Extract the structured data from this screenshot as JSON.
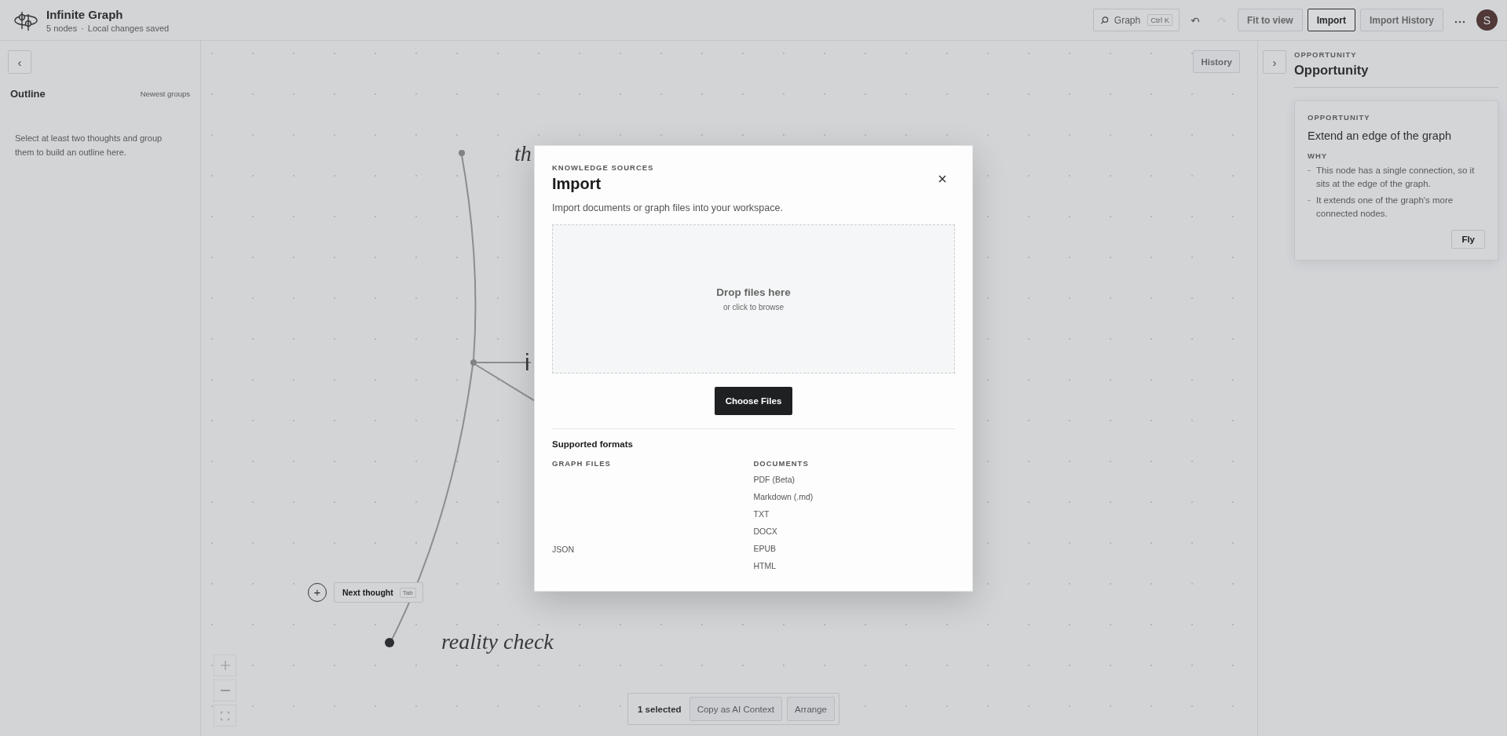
{
  "app": {
    "title": "Infinite Graph",
    "node_count": "5 nodes",
    "separator": "·",
    "save_status": "Local changes saved"
  },
  "toolbar": {
    "search": {
      "label": "Graph",
      "shortcut": "Ctrl K"
    },
    "history_controls": [
      {
        "kind": "undo",
        "disabled": false
      },
      {
        "kind": "redo",
        "disabled": true
      }
    ],
    "buttons": [
      {
        "label": "Fit to view",
        "active": false
      },
      {
        "label": "Import",
        "active": true
      },
      {
        "label": "Import History",
        "active": false
      }
    ],
    "avatar": {
      "initial": "S"
    }
  },
  "outline": {
    "collapse": "‹",
    "title": "Outline",
    "sort": "Newest groups",
    "empty_text": "Select at least two thoughts and group them to build an outline here."
  },
  "canvas": {
    "history_button": "History",
    "nodes": [
      {
        "label": "th",
        "selected": false
      },
      {
        "label": "i",
        "selected": false
      },
      {
        "label": "reality check",
        "selected": true
      }
    ],
    "next_thought": {
      "icon": "+",
      "label": "Next thought",
      "shortcut": "Tab"
    },
    "selection_bar": {
      "count": "1 selected",
      "actions": [
        "Copy as AI Context",
        "Arrange"
      ]
    }
  },
  "inspector": {
    "expand": "›",
    "eyebrow": "OPPORTUNITY",
    "title": "Opportunity",
    "card": {
      "eyebrow": "OPPORTUNITY",
      "title": "Extend an edge of the graph",
      "why_label": "WHY",
      "reasons": [
        "This node has a single connection, so it sits at the edge of the graph.",
        "It extends one of the graph's more connected nodes."
      ],
      "action": "Fly"
    }
  },
  "modal": {
    "eyebrow": "KNOWLEDGE SOURCES",
    "title": "Import",
    "description": "Import documents or graph files into your workspace.",
    "dropzone": {
      "title": "Drop files here",
      "hint": "or click to browse"
    },
    "choose_button": "Choose Files",
    "formats": {
      "title": "Supported formats",
      "groups": [
        {
          "heading": "GRAPH FILES",
          "items": [
            "JSON"
          ]
        },
        {
          "heading": "DOCUMENTS",
          "items": [
            "PDF (Beta)",
            "Markdown (.md)",
            "TXT",
            "DOCX",
            "EPUB",
            "HTML"
          ]
        }
      ]
    }
  }
}
